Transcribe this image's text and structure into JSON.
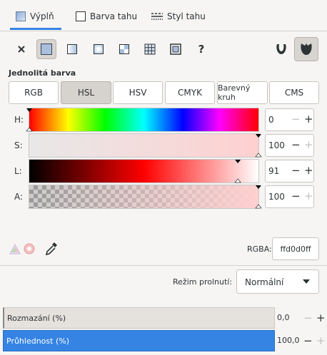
{
  "tabs": [
    {
      "label": "Výplň",
      "icon": "fill-icon",
      "active": true
    },
    {
      "label": "Barva tahu",
      "icon": "stroke-paint-icon",
      "active": false
    },
    {
      "label": "Styl tahu",
      "icon": "stroke-style-icon",
      "active": false
    }
  ],
  "paint_types": [
    "none",
    "flat",
    "linear-gradient",
    "radial-gradient",
    "pattern",
    "mesh",
    "swatch",
    "unset"
  ],
  "paint_type_selected": "flat",
  "unset_label": "?",
  "section_title": "Jednolitá barva",
  "modes": [
    "RGB",
    "HSL",
    "HSV",
    "CMYK",
    "Barevný kruh",
    "CMS"
  ],
  "mode_selected": "HSL",
  "sliders": [
    {
      "label": "H:",
      "value": "0",
      "fraction": 0.0
    },
    {
      "label": "S:",
      "value": "100",
      "fraction": 1.0
    },
    {
      "label": "L:",
      "value": "91",
      "fraction": 0.91
    },
    {
      "label": "A:",
      "value": "100",
      "fraction": 1.0
    }
  ],
  "rgba": {
    "label": "RGBA:",
    "value": "ffd0d0ff"
  },
  "blend": {
    "label": "Režim prolnutí:",
    "value": "Normální"
  },
  "blur": {
    "label": "Rozmazání (%)",
    "value": "0,0"
  },
  "opacity": {
    "label": "Průhlednost (%)",
    "value": "100,0"
  },
  "colors": {
    "accent": "#3584e4",
    "current": "#ffd0d0"
  }
}
